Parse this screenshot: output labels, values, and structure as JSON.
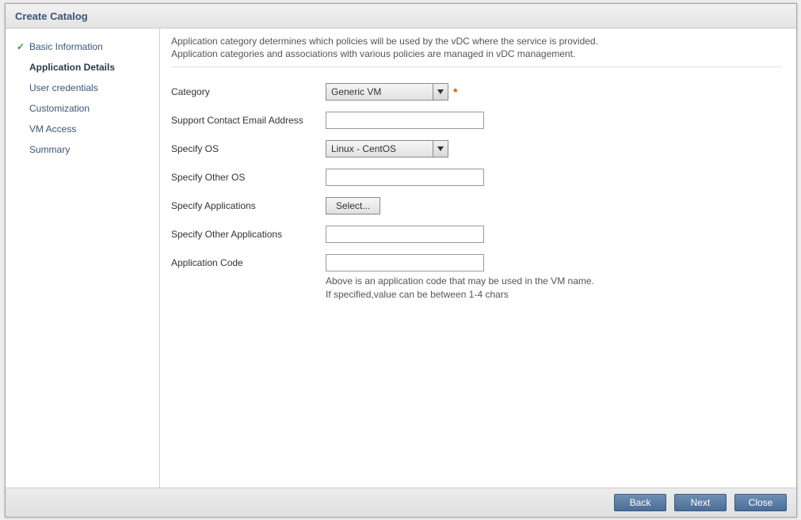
{
  "title": "Create Catalog",
  "sidebar": {
    "steps": [
      {
        "label": "Basic Information",
        "completed": true,
        "active": false
      },
      {
        "label": "Application Details",
        "completed": false,
        "active": true
      },
      {
        "label": "User credentials",
        "completed": false,
        "active": false
      },
      {
        "label": "Customization",
        "completed": false,
        "active": false
      },
      {
        "label": "VM Access",
        "completed": false,
        "active": false
      },
      {
        "label": "Summary",
        "completed": false,
        "active": false
      }
    ]
  },
  "intro": {
    "line1": "Application category determines which policies will be used by the vDC where the service is provided.",
    "line2": "Application categories and associations with various policies are managed in vDC management."
  },
  "form": {
    "category": {
      "label": "Category",
      "value": "Generic VM",
      "required": true
    },
    "supportEmail": {
      "label": "Support Contact Email Address",
      "value": ""
    },
    "os": {
      "label": "Specify OS",
      "value": "Linux - CentOS"
    },
    "otherOs": {
      "label": "Specify Other OS",
      "value": ""
    },
    "apps": {
      "label": "Specify Applications",
      "button": "Select..."
    },
    "otherApps": {
      "label": "Specify Other Applications",
      "value": ""
    },
    "appCode": {
      "label": "Application Code",
      "value": "",
      "hint1": "Above is an application code that may be used in the VM name.",
      "hint2": "If specified,value can be between 1-4 chars"
    }
  },
  "footer": {
    "back": "Back",
    "next": "Next",
    "close": "Close"
  }
}
